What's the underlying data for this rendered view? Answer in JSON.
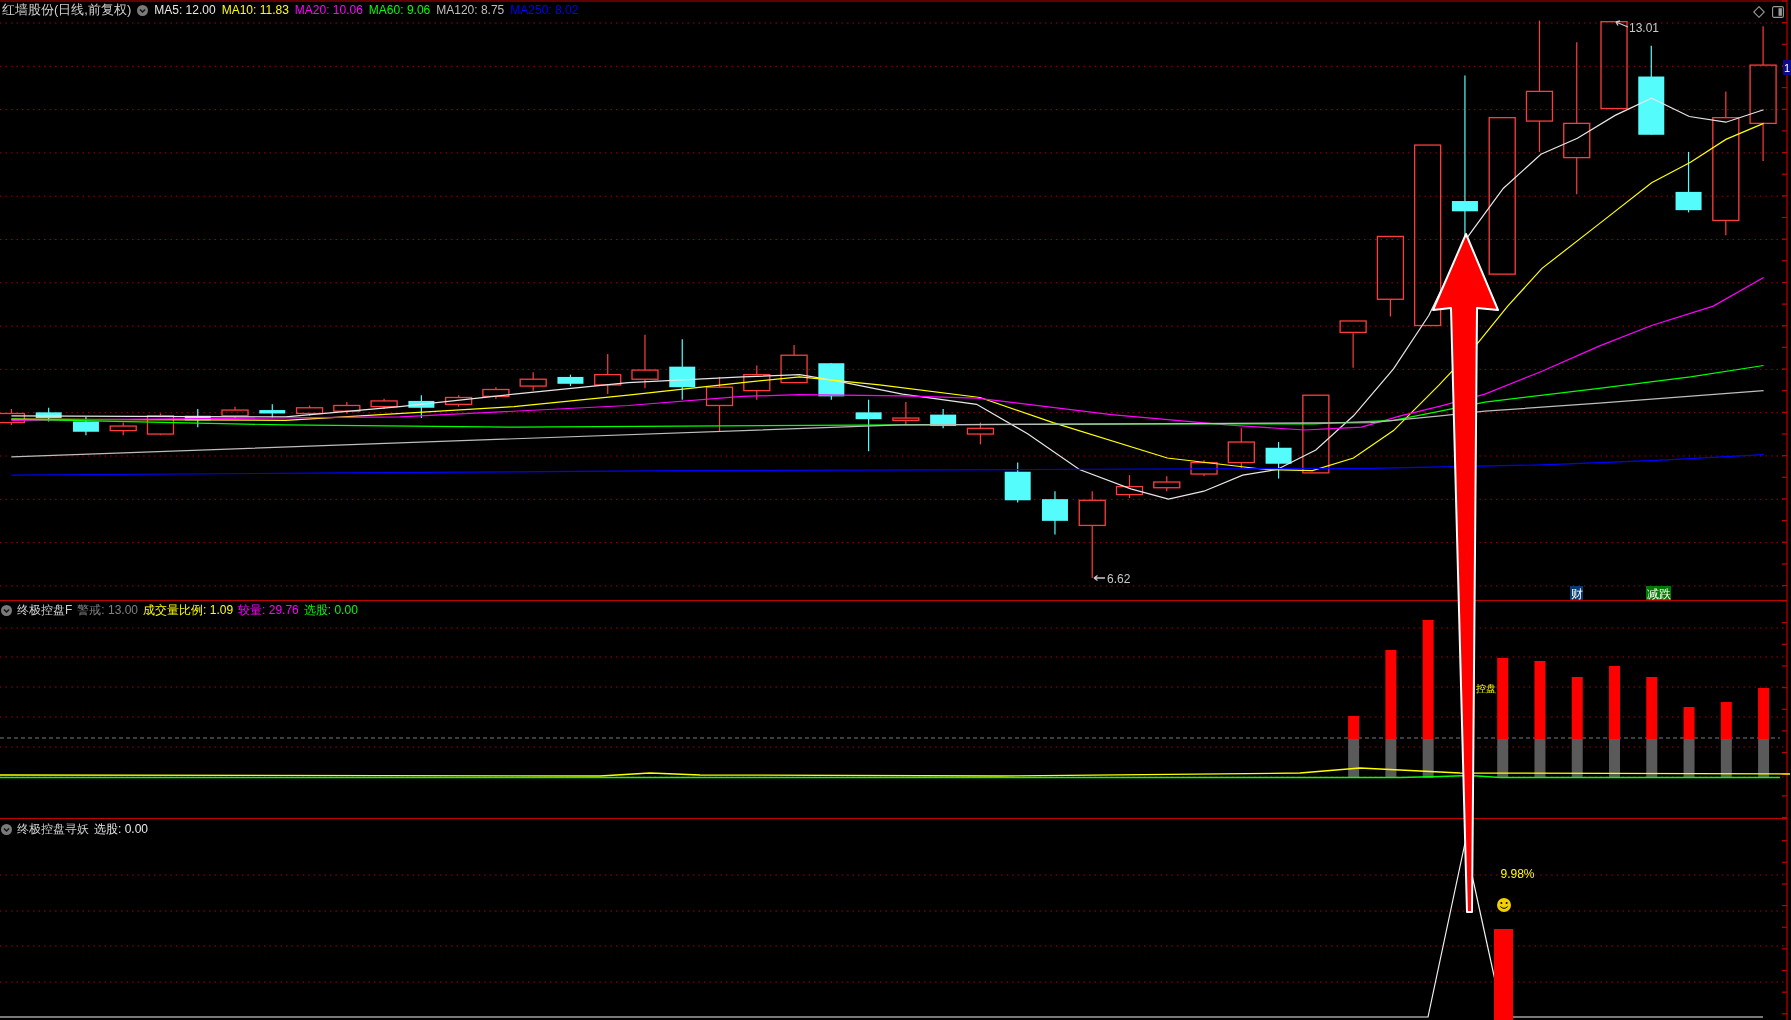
{
  "chart_header": {
    "title": "红墙股份(日线,前复权)",
    "indicators": [
      {
        "label": "MA5: 12.00",
        "color": "#e6e6e6"
      },
      {
        "label": "MA10: 11.83",
        "color": "#ffff00"
      },
      {
        "label": "MA20: 10.06",
        "color": "#ff00ff"
      },
      {
        "label": "MA60: 9.06",
        "color": "#00ff00"
      },
      {
        "label": "MA120: 8.75",
        "color": "#bdbdbd"
      },
      {
        "label": "MA250: 8.02",
        "color": "#0000ff"
      }
    ]
  },
  "price_chart": {
    "high_label": "13.01",
    "low_label": "6.62",
    "price_tag": "1",
    "event_tags": [
      {
        "text": "财",
        "color": "#063a72"
      },
      {
        "text": "减跌",
        "color": "#007a00"
      }
    ]
  },
  "volume_panel": {
    "title": "终极控盘F",
    "readings": [
      {
        "label": "警戒: 13.00",
        "color": "#808080"
      },
      {
        "label": "成交量比例: 1.09",
        "color": "#ffff00"
      },
      {
        "label": "较量: 29.76",
        "color": "#ff00ff"
      },
      {
        "label": "选股: 0.00",
        "color": "#00ff00"
      }
    ],
    "signal_label": "控盘"
  },
  "signal_panel": {
    "title": "终极控盘寻妖",
    "readings": [
      {
        "label": "选股: 0.00",
        "color": "#e8e8e8"
      }
    ],
    "change_label": "9.98%"
  }
}
